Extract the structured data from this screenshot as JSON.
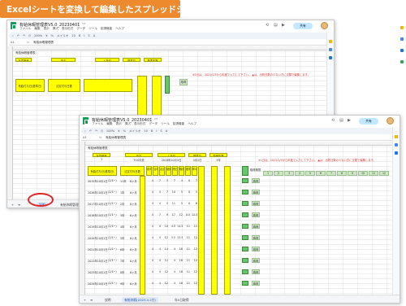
{
  "banner": {
    "title": "Excelシートを変換して編集したスプレッドシート"
  },
  "doc": {
    "title": "有給休暇管理表V5.0_20230401"
  },
  "menu": [
    "ファイル",
    "編集",
    "表示",
    "挿入",
    "表示形式",
    "データ",
    "ツール",
    "拡張機能",
    "ヘルプ"
  ],
  "toolbar": {
    "zoom": "100%",
    "font": "メイリオ",
    "font_size": "10",
    "currency": "¥",
    "percent": "%"
  },
  "share": {
    "label": "共有"
  },
  "formula": {
    "cell_ref": "A1",
    "fx": "fx",
    "text": "有給休暇管理表"
  },
  "sheet_title": "有給休暇管理表",
  "back": {
    "headers": [
      "社員番号",
      "氏名",
      "入社日",
      "基準日",
      "基準年数"
    ],
    "left_col": "有給付与日(基準日)",
    "grant_col": "法定付与日数",
    "note": "※1日は、2021/1/5から年度で入力して下さい。  ▲は、出勤日数の少ない方に交替で編集します。"
  },
  "front": {
    "employee_header": "社員番号",
    "employee_value": "1",
    "name_header": "氏名",
    "name_value": "TGS中央",
    "joined_header": "入社日",
    "joined_value": "2018年10月3日",
    "base_header": "基準日",
    "base_value": "4月1日",
    "years_header": "勤続年数",
    "years_value": "3年",
    "note": "※1日は、2021/1/5から年度で入力して下さい。  ▲は、出勤日数の少ない方に交替で編集します。",
    "left_col": "有給付与日(基準日)",
    "grant_col": "法定付与日数",
    "sub_cols": [
      "前年繰越",
      "当年付与",
      "合計",
      "使用日数",
      "残日数",
      "取得日数",
      "基準日",
      "年5日"
    ],
    "day_cols": [
      "1",
      "2",
      "3",
      "4",
      "5",
      "6",
      "7",
      "8",
      "9",
      "10",
      "11",
      "12"
    ],
    "month_label": "取得期間",
    "rows": [
      {
        "date": "2015年10月1日",
        "term": "(1/1~)",
        "stat": "11年",
        "flag": "6ヶ月",
        "vals": [
          "4",
          "7",
          "3",
          "7",
          "4",
          "0",
          "7"
        ]
      },
      {
        "date": "2016年10月1日",
        "term": "(1/1~)",
        "stat": "1年",
        "flag": "6ヶ月",
        "vals": [
          "4",
          "4",
          "7",
          "10",
          "5",
          "0",
          "5"
        ]
      },
      {
        "date": "2017年10月1日",
        "term": "(1/1~)",
        "stat": "2年",
        "flag": "6ヶ月",
        "vals": [
          "4",
          "4",
          "5",
          "11",
          "5",
          "0",
          "6"
        ]
      },
      {
        "date": "2018年10月1日",
        "term": "(1/1~)",
        "stat": "3年",
        "flag": "6ヶ月",
        "vals": [
          "4",
          "7",
          "9",
          "17",
          "12",
          "0.5",
          "12.5"
        ]
      },
      {
        "date": "2019年10月1日",
        "term": "(1/1~)",
        "stat": "4年",
        "flag": "6ヶ月",
        "vals": [
          "4",
          "4",
          "10",
          "4.5",
          "14.5",
          "11",
          "11"
        ]
      },
      {
        "date": "2020年10月1日",
        "term": "(1/1~)",
        "stat": "5年",
        "flag": "6ヶ月",
        "vals": [
          "4",
          "4",
          "12",
          "3.5",
          "13.5",
          "11",
          "12"
        ]
      },
      {
        "date": "2021年10月1日",
        "term": "(1/1~)",
        "stat": "6年",
        "flag": "6ヶ月",
        "vals": [
          "4",
          "4",
          "14",
          "4",
          "16",
          "11",
          "12"
        ]
      },
      {
        "date": "2022年10月1日",
        "term": "(1/1~)",
        "stat": "7年",
        "flag": "6ヶ月",
        "vals": [
          "4",
          "4",
          "12",
          "4",
          "16",
          "11",
          "12"
        ]
      },
      {
        "date": "2023年10月1日",
        "term": "(1/1~)",
        "stat": "8年",
        "flag": "6ヶ月",
        "vals": [
          "4",
          "4",
          "12",
          "4",
          "16",
          "11",
          "12"
        ]
      },
      {
        "date": "2024年10月1日",
        "term": "(1/1~)",
        "stat": "9年",
        "flag": "6ヶ月",
        "vals": [
          "4",
          "4",
          "12",
          "4",
          "16",
          "11",
          "12"
        ]
      }
    ],
    "side_labels": [
      "取得",
      "取得",
      "取得",
      "取得",
      "取得",
      "取得",
      "取得",
      "取得",
      "取得",
      "取得"
    ]
  },
  "sheets": {
    "tab1": "説明",
    "tab2": "有給休暇管理表",
    "tab3": "有給休暇(2023.4.1付)",
    "tab4": "年5日取得"
  },
  "colors": {
    "banner": "#ee8a2e",
    "highlight": "#ffff00",
    "green": "#66c766",
    "ellipse": "#e0252a"
  }
}
